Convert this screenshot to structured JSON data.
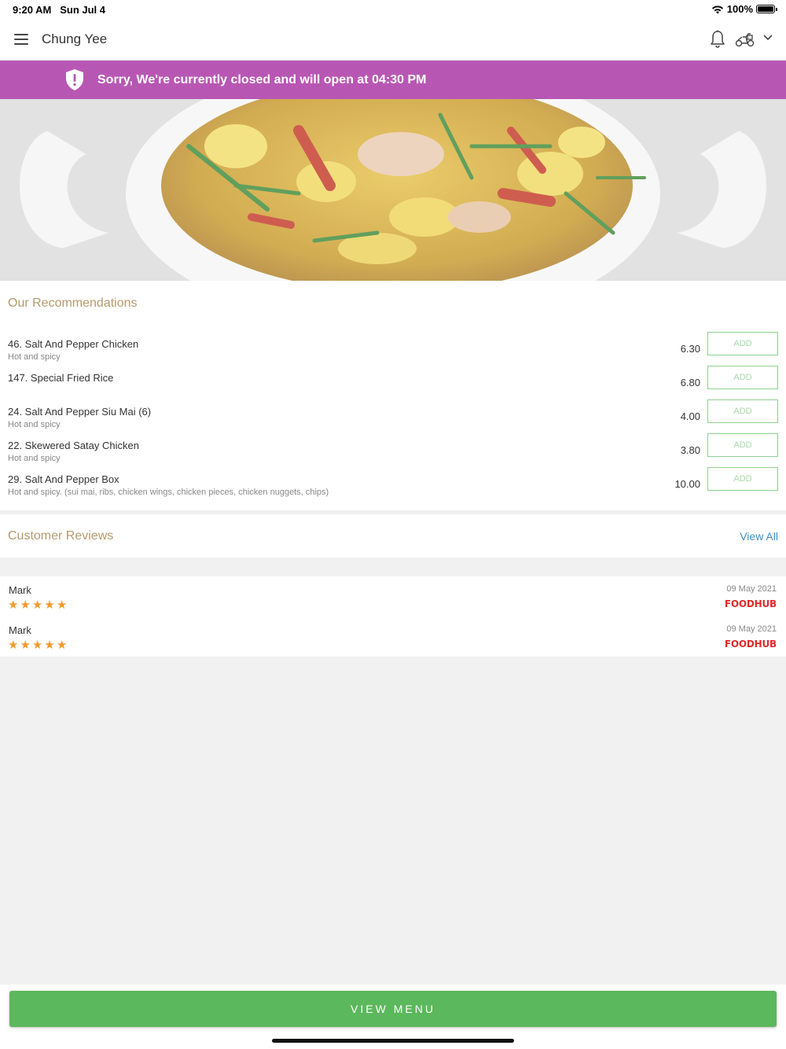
{
  "status": {
    "time": "9:20 AM",
    "date": "Sun Jul 4",
    "battery": "100%"
  },
  "header": {
    "restaurant_name": "Chung Yee",
    "icons": [
      "menu-icon",
      "bell-icon",
      "delivery-icon",
      "chevron-down-icon"
    ]
  },
  "banner": {
    "text": "Sorry, We're currently closed and will open at 04:30 PM",
    "color": "#b857b3"
  },
  "recommendations": {
    "title": "Our Recommendations",
    "items": [
      {
        "name": "46. Salt And Pepper Chicken",
        "desc": "Hot and spicy",
        "price": "6.30",
        "add": "ADD"
      },
      {
        "name": "147. Special Fried Rice",
        "desc": "",
        "price": "6.80",
        "add": "ADD"
      },
      {
        "name": "24. Salt And Pepper Siu Mai (6)",
        "desc": "Hot and spicy",
        "price": "4.00",
        "add": "ADD"
      },
      {
        "name": "22. Skewered Satay Chicken",
        "desc": "Hot and spicy",
        "price": "3.80",
        "add": "ADD"
      },
      {
        "name": "29. Salt And Pepper Box",
        "desc": "Hot and spicy. (sui mai, ribs, chicken wings, chicken pieces, chicken nuggets, chips)",
        "price": "10.00",
        "add": "ADD"
      }
    ]
  },
  "reviews": {
    "title": "Customer Reviews",
    "view_all": "View All",
    "items": [
      {
        "name": "Mark",
        "rating": 5,
        "date": "09 May 2021",
        "source": "FOODHUB"
      },
      {
        "name": "Mark",
        "rating": 5,
        "date": "09 May 2021",
        "source": "FOODHUB"
      }
    ]
  },
  "footer": {
    "button_label": "VIEW MENU",
    "color": "#5cb85c"
  }
}
